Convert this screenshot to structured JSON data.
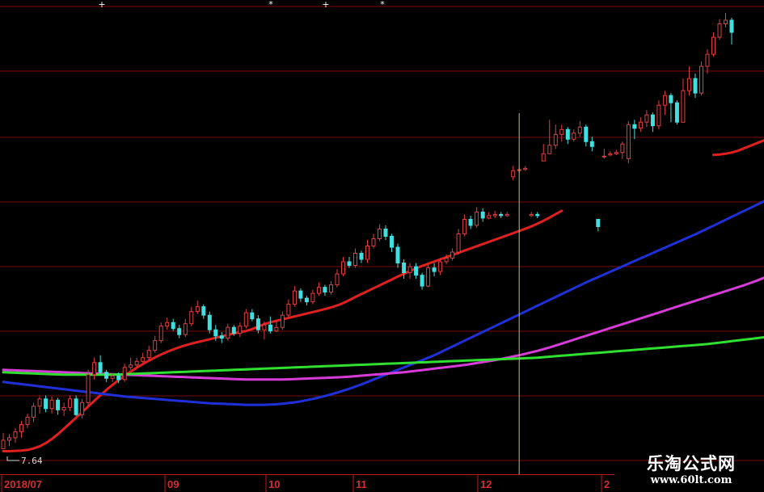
{
  "chart_data": {
    "type": "candlestick",
    "x_labels": [
      "2018/07",
      "09",
      "10",
      "11",
      "12",
      "2"
    ],
    "low_annotation": "7.64",
    "colors": {
      "background": "#000000",
      "grid": "#7a0a0a",
      "axis": "#c01818",
      "up": "#e04040",
      "down": "#40e0e0",
      "cursor": "#b8b890"
    },
    "candles": [
      [
        8.2,
        8.5,
        7.9,
        7.85
      ],
      [
        8.3,
        8.45,
        7.95,
        8.2
      ],
      [
        8.55,
        8.7,
        8.1,
        8.3
      ],
      [
        8.85,
        9.0,
        8.3,
        8.55
      ],
      [
        9.15,
        9.3,
        8.7,
        8.85
      ],
      [
        9.6,
        9.75,
        8.95,
        9.15
      ],
      [
        9.9,
        10.0,
        9.3,
        9.6
      ],
      [
        9.5,
        10.05,
        9.35,
        9.9
      ],
      [
        9.85,
        10.0,
        9.3,
        9.5
      ],
      [
        9.45,
        9.95,
        9.25,
        9.85
      ],
      [
        9.55,
        9.75,
        9.2,
        9.45
      ],
      [
        9.9,
        10.05,
        9.4,
        9.55
      ],
      [
        9.25,
        10.05,
        9.2,
        9.9
      ],
      [
        9.75,
        9.9,
        9.1,
        9.25
      ],
      [
        10.9,
        11.1,
        9.6,
        9.75
      ],
      [
        11.4,
        11.6,
        10.7,
        10.9
      ],
      [
        11.0,
        11.7,
        10.9,
        11.4
      ],
      [
        10.75,
        11.1,
        10.6,
        11.0
      ],
      [
        10.85,
        10.95,
        10.6,
        10.75
      ],
      [
        10.7,
        11.0,
        10.55,
        10.85
      ],
      [
        11.2,
        11.35,
        10.6,
        10.7
      ],
      [
        11.3,
        11.6,
        11.1,
        11.2
      ],
      [
        11.45,
        11.6,
        11.2,
        11.3
      ],
      [
        11.6,
        11.8,
        11.4,
        11.45
      ],
      [
        11.9,
        12.1,
        11.5,
        11.6
      ],
      [
        12.3,
        12.5,
        11.8,
        11.9
      ],
      [
        12.9,
        13.05,
        12.2,
        12.3
      ],
      [
        13.05,
        13.25,
        12.75,
        12.9
      ],
      [
        12.8,
        13.2,
        12.7,
        13.05
      ],
      [
        12.55,
        12.95,
        12.4,
        12.8
      ],
      [
        13.0,
        13.2,
        12.45,
        12.55
      ],
      [
        13.5,
        13.7,
        12.9,
        13.0
      ],
      [
        13.7,
        13.95,
        13.4,
        13.5
      ],
      [
        13.35,
        13.8,
        13.2,
        13.7
      ],
      [
        12.75,
        13.5,
        12.6,
        13.35
      ],
      [
        12.5,
        12.95,
        12.3,
        12.75
      ],
      [
        12.4,
        12.65,
        12.2,
        12.5
      ],
      [
        12.85,
        13.0,
        12.3,
        12.4
      ],
      [
        12.6,
        12.95,
        12.5,
        12.85
      ],
      [
        12.9,
        13.05,
        12.45,
        12.6
      ],
      [
        13.45,
        13.6,
        12.8,
        12.9
      ],
      [
        13.2,
        13.6,
        13.1,
        13.45
      ],
      [
        12.75,
        13.35,
        12.6,
        13.2
      ],
      [
        12.95,
        13.1,
        12.35,
        12.75
      ],
      [
        12.7,
        13.3,
        12.6,
        12.95
      ],
      [
        12.85,
        13.1,
        12.65,
        12.7
      ],
      [
        13.35,
        13.5,
        12.75,
        12.85
      ],
      [
        13.8,
        14.0,
        13.25,
        13.35
      ],
      [
        14.35,
        14.55,
        13.7,
        13.8
      ],
      [
        14.05,
        14.45,
        13.9,
        14.35
      ],
      [
        13.9,
        14.15,
        13.75,
        14.05
      ],
      [
        14.25,
        14.4,
        13.8,
        13.9
      ],
      [
        14.5,
        14.7,
        14.15,
        14.25
      ],
      [
        14.3,
        14.6,
        14.15,
        14.5
      ],
      [
        14.6,
        14.75,
        14.2,
        14.3
      ],
      [
        15.05,
        15.25,
        14.5,
        14.6
      ],
      [
        15.55,
        15.75,
        14.95,
        15.05
      ],
      [
        15.4,
        15.75,
        15.3,
        15.55
      ],
      [
        15.9,
        16.1,
        15.3,
        15.4
      ],
      [
        15.65,
        16.0,
        15.5,
        15.9
      ],
      [
        16.2,
        16.45,
        15.5,
        15.65
      ],
      [
        16.5,
        16.7,
        16.1,
        16.2
      ],
      [
        16.9,
        17.1,
        16.4,
        16.5
      ],
      [
        16.6,
        17.05,
        16.45,
        16.9
      ],
      [
        16.15,
        16.7,
        15.95,
        16.6
      ],
      [
        15.5,
        16.3,
        15.3,
        16.15
      ],
      [
        15.1,
        15.65,
        14.85,
        15.5
      ],
      [
        15.35,
        15.5,
        14.85,
        15.1
      ],
      [
        15.0,
        15.5,
        14.85,
        15.35
      ],
      [
        14.55,
        15.1,
        14.4,
        15.0
      ],
      [
        15.3,
        15.45,
        14.5,
        14.55
      ],
      [
        15.15,
        15.5,
        14.95,
        15.3
      ],
      [
        15.55,
        15.7,
        15.0,
        15.15
      ],
      [
        15.7,
        15.85,
        15.45,
        15.55
      ],
      [
        15.95,
        16.1,
        15.6,
        15.7
      ],
      [
        16.7,
        16.9,
        15.85,
        15.95
      ],
      [
        17.3,
        17.5,
        16.6,
        16.7
      ],
      [
        17.05,
        17.45,
        16.9,
        17.3
      ],
      [
        17.6,
        17.8,
        16.95,
        17.05
      ],
      [
        17.35,
        17.75,
        17.2,
        17.6
      ],
      [
        17.45,
        17.6,
        17.3,
        17.35
      ],
      [
        17.5,
        17.65,
        17.35,
        17.45
      ],
      [
        17.45,
        17.6,
        17.35,
        17.5
      ],
      [
        17.5,
        17.6,
        17.4,
        17.45
      ],
      [
        19.3,
        19.5,
        18.9,
        19.05
      ],
      [
        19.35,
        19.5,
        19.2,
        19.3
      ],
      [
        19.4,
        19.5,
        19.3,
        19.35
      ],
      [
        17.5,
        17.6,
        17.4,
        17.45
      ],
      [
        17.45,
        17.6,
        17.35,
        17.5
      ],
      [
        20.0,
        20.4,
        19.7,
        19.7
      ],
      [
        20.35,
        21.4,
        20.0,
        20.0
      ],
      [
        20.8,
        21.2,
        20.2,
        20.35
      ],
      [
        21.0,
        21.2,
        20.5,
        20.8
      ],
      [
        20.6,
        21.1,
        20.4,
        21.0
      ],
      [
        20.85,
        21.0,
        20.5,
        20.6
      ],
      [
        21.1,
        21.35,
        20.7,
        20.85
      ],
      [
        20.5,
        21.2,
        20.3,
        21.1
      ],
      [
        20.3,
        20.7,
        20.1,
        20.5
      ],
      [
        17.0,
        17.3,
        16.8,
        17.3
      ],
      [
        19.9,
        20.2,
        19.8,
        19.9
      ],
      [
        20.0,
        20.1,
        19.9,
        19.95
      ],
      [
        20.05,
        20.15,
        19.95,
        20.0
      ],
      [
        20.4,
        20.5,
        19.8,
        20.05
      ],
      [
        21.2,
        21.35,
        19.6,
        19.8
      ],
      [
        21.05,
        21.4,
        20.6,
        21.2
      ],
      [
        21.3,
        21.5,
        20.9,
        21.05
      ],
      [
        21.6,
        21.8,
        21.1,
        21.3
      ],
      [
        21.15,
        21.7,
        20.9,
        21.6
      ],
      [
        22.0,
        22.2,
        21.0,
        21.15
      ],
      [
        22.4,
        22.6,
        21.6,
        22.0
      ],
      [
        22.1,
        22.5,
        21.3,
        22.4
      ],
      [
        21.3,
        22.2,
        21.2,
        22.1
      ],
      [
        22.6,
        23.1,
        21.4,
        21.3
      ],
      [
        23.1,
        23.6,
        22.4,
        22.6
      ],
      [
        22.5,
        23.3,
        22.3,
        23.1
      ],
      [
        23.6,
        23.8,
        22.4,
        22.5
      ],
      [
        24.1,
        24.3,
        23.3,
        23.6
      ],
      [
        24.8,
        25.0,
        24.0,
        24.1
      ],
      [
        25.35,
        25.55,
        24.7,
        24.8
      ],
      [
        25.5,
        25.8,
        25.2,
        25.35
      ],
      [
        25.0,
        25.6,
        24.5,
        25.5
      ]
    ],
    "ma_lines": [
      {
        "color": "#e02020",
        "values": [
          7.75,
          7.75,
          7.76,
          7.77,
          7.8,
          7.86,
          7.95,
          8.08,
          8.25,
          8.45,
          8.67,
          8.9,
          9.13,
          9.36,
          9.59,
          9.82,
          10.05,
          10.27,
          10.48,
          10.68,
          10.86,
          11.03,
          11.19,
          11.34,
          11.48,
          11.61,
          11.73,
          11.84,
          11.94,
          12.03,
          12.11,
          12.18,
          12.24,
          12.3,
          12.36,
          12.42,
          12.48,
          12.54,
          12.6,
          12.65,
          12.7,
          12.78,
          12.88,
          12.98,
          13.06,
          13.12,
          13.18,
          13.24,
          13.3,
          13.36,
          13.42,
          13.48,
          13.54,
          13.6,
          13.67,
          13.75,
          13.85,
          13.97,
          14.1,
          14.22,
          14.34,
          14.46,
          14.58,
          14.7,
          14.82,
          14.94,
          15.06,
          15.17,
          15.28,
          15.38,
          15.47,
          15.56,
          15.65,
          15.74,
          15.83,
          15.92,
          16.01,
          16.1,
          16.19,
          16.28,
          16.37,
          16.46,
          16.55,
          16.64,
          16.73,
          16.82,
          16.91,
          17.01,
          17.12,
          17.24,
          17.37,
          17.51,
          17.65,
          null,
          null,
          null,
          null,
          null,
          null,
          null,
          null,
          null,
          null,
          null,
          null,
          null,
          null,
          null,
          null,
          null,
          null,
          null,
          null,
          null,
          null,
          null,
          null,
          19.95,
          19.97,
          20.0,
          20.05,
          20.12,
          20.22,
          20.32,
          20.42,
          20.52,
          20.62,
          20.73,
          20.86,
          21.02,
          21.22,
          21.46,
          21.75,
          22.08,
          22.44
        ]
      },
      {
        "color": "#2030d8",
        "values": [
          10.6,
          10.57,
          10.54,
          10.51,
          10.48,
          10.45,
          10.42,
          10.39,
          10.36,
          10.33,
          10.3,
          10.27,
          10.24,
          10.21,
          10.18,
          10.15,
          10.12,
          10.09,
          10.06,
          10.03,
          10.0,
          9.98,
          9.96,
          9.94,
          9.92,
          9.9,
          9.88,
          9.86,
          9.84,
          9.82,
          9.8,
          9.78,
          9.76,
          9.74,
          9.72,
          9.71,
          9.7,
          9.69,
          9.68,
          9.67,
          9.66,
          9.66,
          9.66,
          9.66,
          9.67,
          9.68,
          9.7,
          9.73,
          9.76,
          9.8,
          9.85,
          9.9,
          9.96,
          10.02,
          10.09,
          10.16,
          10.24,
          10.32,
          10.41,
          10.5,
          10.6,
          10.7,
          10.8,
          10.9,
          11.0,
          11.1,
          11.2,
          11.3,
          11.4,
          11.5,
          11.6,
          11.7,
          11.82,
          11.94,
          12.06,
          12.18,
          12.3,
          12.42,
          12.54,
          12.66,
          12.78,
          12.9,
          13.02,
          13.14,
          13.26,
          13.38,
          13.5,
          13.62,
          13.74,
          13.86,
          13.98,
          14.1,
          14.22,
          14.34,
          14.46,
          14.58,
          14.7,
          14.81,
          14.92,
          15.03,
          15.14,
          15.25,
          15.36,
          15.47,
          15.58,
          15.69,
          15.8,
          15.91,
          16.02,
          16.13,
          16.24,
          16.35,
          16.46,
          16.57,
          16.68,
          16.8,
          16.92,
          17.04,
          17.16,
          17.28,
          17.4,
          17.52,
          17.64,
          17.76,
          17.88,
          18.0,
          18.12,
          18.24,
          18.36,
          18.48,
          18.6,
          18.72,
          18.84,
          18.96,
          19.08
        ]
      },
      {
        "color": "#d83cd8",
        "values": [
          11.1,
          11.09,
          11.08,
          11.07,
          11.06,
          11.05,
          11.04,
          11.03,
          11.02,
          11.01,
          11.0,
          10.99,
          10.98,
          10.97,
          10.96,
          10.95,
          10.94,
          10.93,
          10.92,
          10.91,
          10.9,
          10.89,
          10.88,
          10.87,
          10.86,
          10.85,
          10.84,
          10.83,
          10.82,
          10.81,
          10.8,
          10.79,
          10.78,
          10.77,
          10.76,
          10.75,
          10.74,
          10.73,
          10.72,
          10.71,
          10.7,
          10.7,
          10.7,
          10.7,
          10.7,
          10.7,
          10.7,
          10.71,
          10.72,
          10.73,
          10.74,
          10.75,
          10.76,
          10.77,
          10.78,
          10.79,
          10.8,
          10.82,
          10.84,
          10.86,
          10.88,
          10.9,
          10.92,
          10.94,
          10.96,
          10.98,
          11.0,
          11.03,
          11.06,
          11.09,
          11.12,
          11.15,
          11.18,
          11.21,
          11.24,
          11.27,
          11.3,
          11.34,
          11.38,
          11.42,
          11.46,
          11.5,
          11.55,
          11.6,
          11.65,
          11.7,
          11.76,
          11.82,
          11.88,
          11.95,
          12.02,
          12.1,
          12.18,
          12.26,
          12.34,
          12.42,
          12.5,
          12.58,
          12.66,
          12.74,
          12.82,
          12.9,
          12.98,
          13.06,
          13.14,
          13.22,
          13.3,
          13.38,
          13.46,
          13.54,
          13.62,
          13.7,
          13.78,
          13.86,
          13.94,
          14.02,
          14.1,
          14.18,
          14.26,
          14.34,
          14.42,
          14.5,
          14.58,
          14.67,
          14.76,
          14.86,
          14.96,
          15.07,
          15.18,
          15.3,
          15.42,
          15.55,
          15.68,
          15.82,
          15.97,
          16.13
        ]
      },
      {
        "color": "#30e030",
        "values": [
          11.0,
          10.99,
          10.98,
          10.97,
          10.96,
          10.95,
          10.94,
          10.93,
          10.92,
          10.91,
          10.9,
          10.9,
          10.9,
          10.9,
          10.9,
          10.9,
          10.9,
          10.9,
          10.9,
          10.91,
          10.92,
          10.93,
          10.94,
          10.95,
          10.96,
          10.97,
          10.98,
          10.99,
          11.0,
          11.01,
          11.02,
          11.03,
          11.04,
          11.05,
          11.06,
          11.07,
          11.08,
          11.09,
          11.1,
          11.11,
          11.12,
          11.13,
          11.14,
          11.15,
          11.16,
          11.17,
          11.18,
          11.19,
          11.2,
          11.21,
          11.22,
          11.23,
          11.24,
          11.25,
          11.26,
          11.27,
          11.28,
          11.29,
          11.3,
          11.31,
          11.32,
          11.33,
          11.34,
          11.35,
          11.36,
          11.37,
          11.38,
          11.39,
          11.4,
          11.41,
          11.42,
          11.43,
          11.44,
          11.45,
          11.46,
          11.47,
          11.48,
          11.49,
          11.5,
          11.51,
          11.52,
          11.53,
          11.54,
          11.55,
          11.56,
          11.57,
          11.58,
          11.59,
          11.6,
          11.62,
          11.64,
          11.66,
          11.68,
          11.7,
          11.72,
          11.74,
          11.76,
          11.78,
          11.8,
          11.82,
          11.84,
          11.86,
          11.88,
          11.9,
          11.92,
          11.94,
          11.96,
          11.98,
          12.0,
          12.02,
          12.04,
          12.06,
          12.08,
          12.1,
          12.12,
          12.14,
          12.16,
          12.19,
          12.22,
          12.25,
          12.28,
          12.31,
          12.34,
          12.37,
          12.4,
          12.43,
          12.46,
          12.5,
          12.54,
          12.58,
          12.62,
          12.66,
          12.7,
          12.75,
          12.8,
          12.85,
          12.9
        ]
      }
    ]
  },
  "watermark": {
    "site_name": "乐淘公式网",
    "url": "www.60lt.com"
  }
}
